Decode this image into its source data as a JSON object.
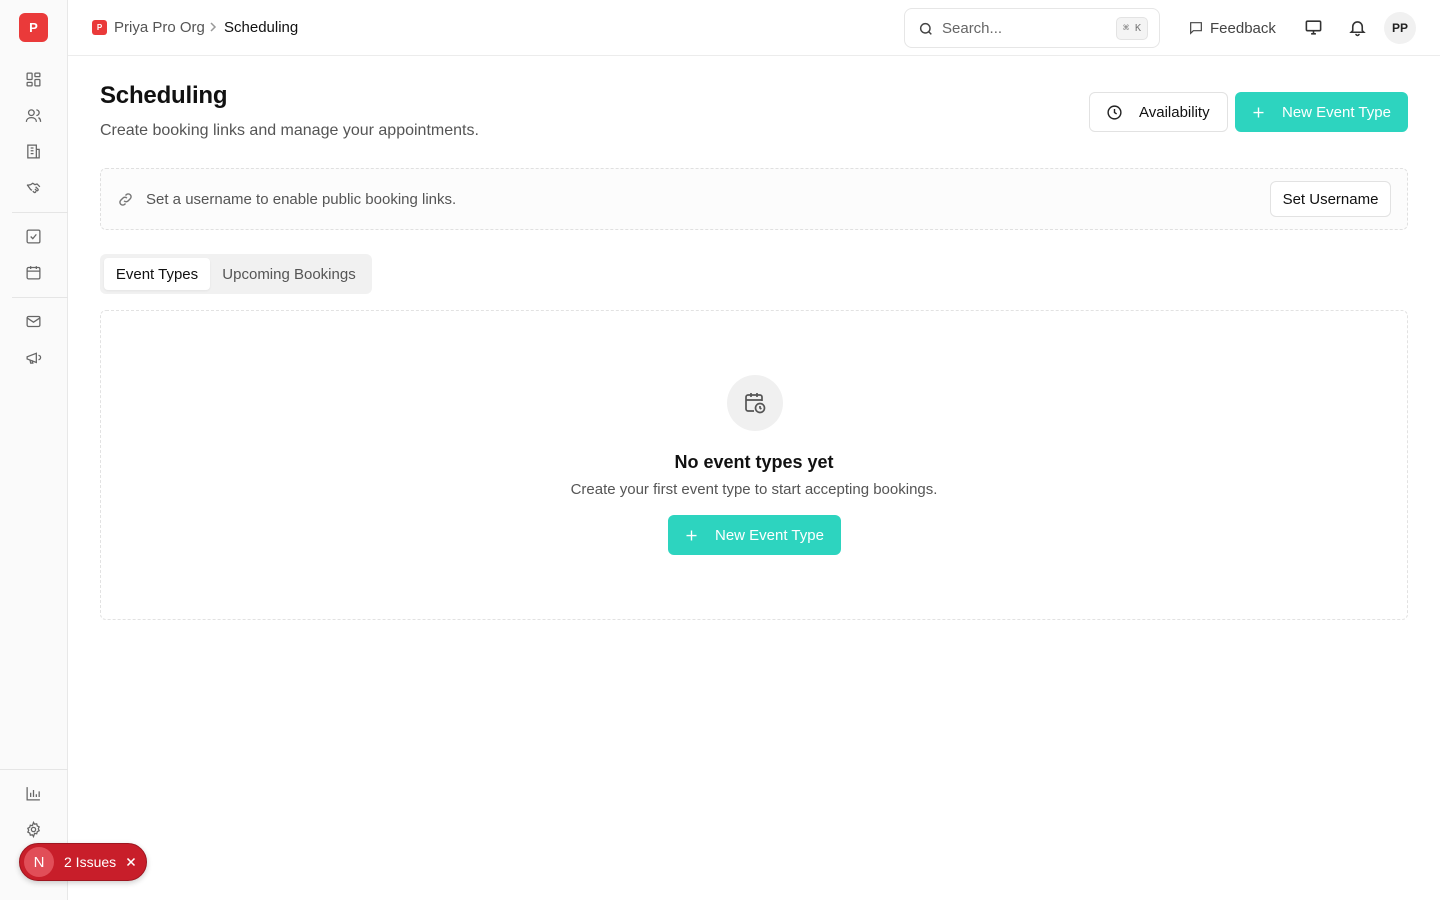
{
  "sidebar": {
    "logo_letter": "P",
    "icons": [
      "dashboard-icon",
      "users-icon",
      "building-icon",
      "handshake-icon",
      "task-check-icon",
      "calendar-icon",
      "mail-icon",
      "megaphone-icon",
      "bar-chart-icon",
      "gear-icon"
    ]
  },
  "topbar": {
    "org_badge": "P",
    "org_name": "Priya Pro Org",
    "current_page": "Scheduling",
    "search_placeholder": "Search...",
    "search_shortcut": "⌘ K",
    "feedback_label": "Feedback",
    "avatar_initials": "PP"
  },
  "page": {
    "title": "Scheduling",
    "subtitle": "Create booking links and manage your appointments.",
    "availability_label": "Availability",
    "new_event_label": "New Event Type"
  },
  "notice": {
    "text": "Set a username to enable public booking links.",
    "button_label": "Set Username"
  },
  "tabs": [
    {
      "label": "Event Types",
      "active": true
    },
    {
      "label": "Upcoming Bookings",
      "active": false
    }
  ],
  "empty_state": {
    "title": "No event types yet",
    "description": "Create your first event type to start accepting bookings.",
    "button_label": "New Event Type"
  },
  "issues_toast": {
    "badge": "N",
    "label": "2 Issues"
  },
  "colors": {
    "accent": "#2dd4bf",
    "brand": "#ea3a3a",
    "issues": "#c81e2a"
  }
}
